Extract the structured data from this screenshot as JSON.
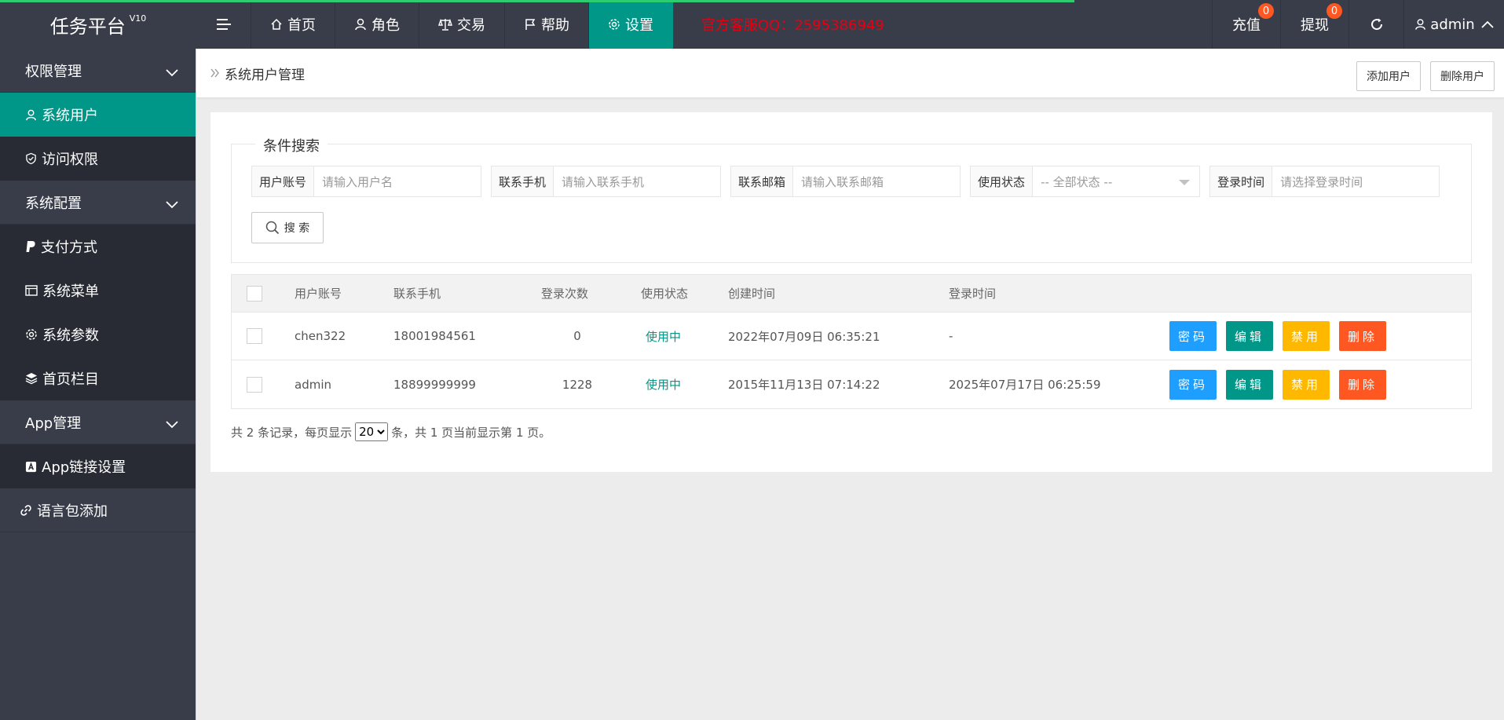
{
  "header": {
    "logo": "任务平台",
    "logo_version": "V10",
    "nav": [
      {
        "label": "首页"
      },
      {
        "label": "角色"
      },
      {
        "label": "交易"
      },
      {
        "label": "帮助"
      },
      {
        "label": "设置"
      }
    ],
    "qq_notice": "官方客服QQ：2595386949",
    "recharge": {
      "label": "充值",
      "badge": "0"
    },
    "withdraw": {
      "label": "提现",
      "badge": "0"
    },
    "user": "admin"
  },
  "sidebar": {
    "groups": [
      {
        "label": "权限管理",
        "items": [
          {
            "label": "系统用户"
          },
          {
            "label": "访问权限"
          }
        ]
      },
      {
        "label": "系统配置",
        "items": [
          {
            "label": "支付方式"
          },
          {
            "label": "系统菜单"
          },
          {
            "label": "系统参数"
          },
          {
            "label": "首页栏目"
          }
        ]
      },
      {
        "label": "App管理",
        "items": [
          {
            "label": "App链接设置"
          }
        ]
      },
      {
        "label": "语言包添加"
      }
    ]
  },
  "breadcrumb": {
    "title": "系统用户管理",
    "add_button": "添加用户",
    "delete_button": "删除用户"
  },
  "search": {
    "legend": "条件搜索",
    "fields": [
      {
        "label": "用户账号",
        "placeholder": "请输入用户名"
      },
      {
        "label": "联系手机",
        "placeholder": "请输入联系手机"
      },
      {
        "label": "联系邮箱",
        "placeholder": "请输入联系邮箱"
      },
      {
        "label": "使用状态",
        "placeholder": "-- 全部状态 --"
      },
      {
        "label": "登录时间",
        "placeholder": "请选择登录时间"
      }
    ],
    "button": "搜 索"
  },
  "table": {
    "columns": [
      "用户账号",
      "联系手机",
      "登录次数",
      "使用状态",
      "创建时间",
      "登录时间"
    ],
    "rows": [
      {
        "account": "chen322",
        "phone": "18001984561",
        "logins": "0",
        "status": "使用中",
        "created": "2022年07月09日 06:35:21",
        "last_login": "-"
      },
      {
        "account": "admin",
        "phone": "18899999999",
        "logins": "1228",
        "status": "使用中",
        "created": "2015年11月13日 07:14:22",
        "last_login": "2025年07月17日 06:25:59"
      }
    ],
    "actions": {
      "password": "密码",
      "edit": "编辑",
      "disable": "禁用",
      "delete": "删除"
    }
  },
  "pager": {
    "prefix": "共 2 条记录，每页显示",
    "page_size": "20",
    "suffix": "条，共 1 页当前显示第 1 页。"
  },
  "colors": {
    "header_bg": "#393d49",
    "active": "#009688",
    "qq_red": "#e60012",
    "badge": "#ff5722"
  }
}
